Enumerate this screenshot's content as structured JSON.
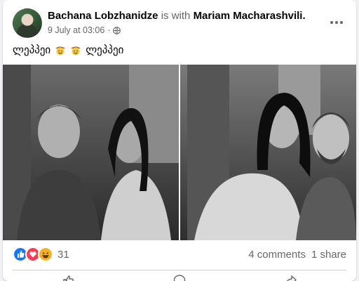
{
  "post": {
    "author": "Bachana Lobzhanidze",
    "with_text": "is with",
    "tagged": "Mariam Macharashvili.",
    "timestamp": "9 July at 03:06",
    "separator": "·",
    "privacy_icon": "globe-icon",
    "caption_word_1": "ლეპპეი",
    "caption_word_2": "ლეპპეი",
    "caption_emoji": "cowboy-face-emoji"
  },
  "stats": {
    "reactions": [
      "like",
      "love",
      "haha"
    ],
    "reaction_count": "31",
    "comments": "4 comments",
    "shares": "1 share"
  },
  "colors": {
    "like": "#1877f2",
    "love": "#f33e58",
    "haha": "#f7b125",
    "text_secondary": "#65676b"
  }
}
